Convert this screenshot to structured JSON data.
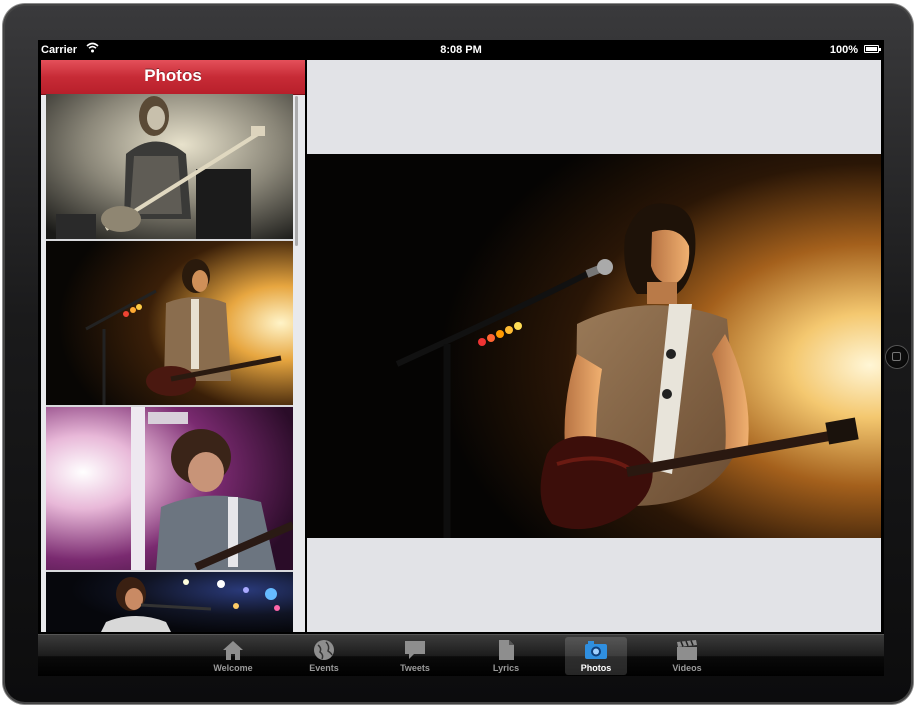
{
  "status_bar": {
    "carrier": "Carrier",
    "time": "8:08 PM",
    "battery": "100%"
  },
  "left_panel": {
    "title": "Photos",
    "thumbnails": [
      {
        "alt": "Bassist playing on stage (black & white)"
      },
      {
        "alt": "Guitarist at microphone in stage light"
      },
      {
        "alt": "Guitarist singing in purple light"
      },
      {
        "alt": "Singer at microphone under stage lights"
      }
    ]
  },
  "detail": {
    "alt": "Guitarist at microphone lit by golden stage light"
  },
  "tab_bar": {
    "tabs": [
      {
        "label": "Welcome",
        "icon": "home-icon",
        "active": false
      },
      {
        "label": "Events",
        "icon": "globe-icon",
        "active": false
      },
      {
        "label": "Tweets",
        "icon": "speech-bubble-icon",
        "active": false
      },
      {
        "label": "Lyrics",
        "icon": "document-icon",
        "active": false
      },
      {
        "label": "Photos",
        "icon": "camera-icon",
        "active": true
      },
      {
        "label": "Videos",
        "icon": "clapperboard-icon",
        "active": false
      }
    ]
  },
  "colors": {
    "header_red": "#c72b36",
    "panel_bg": "#e2e3e7",
    "tab_active": "#ffffff"
  }
}
